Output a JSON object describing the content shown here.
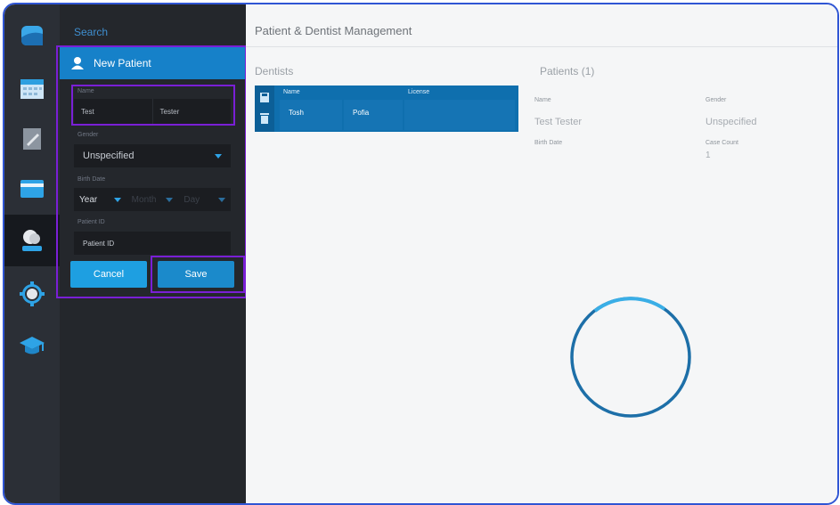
{
  "sidebar": {
    "search_label": "Search",
    "new_patient_label": "New Patient",
    "form": {
      "name_label": "Name",
      "first_name": "Test",
      "last_name": "Tester",
      "gender_label": "Gender",
      "gender_value": "Unspecified",
      "birth_date_label": "Birth Date",
      "year": "Year",
      "month": "Month",
      "day": "Day",
      "patient_id_label": "Patient ID",
      "patient_id_placeholder": "Patient ID",
      "cancel_label": "Cancel",
      "save_label": "Save"
    }
  },
  "main": {
    "title": "Patient & Dentist Management",
    "dentists": {
      "heading": "Dentists",
      "columns": [
        "Name",
        "License"
      ],
      "rows": [
        {
          "first": "Tosh",
          "last": "Pofia",
          "license": ""
        }
      ]
    },
    "patients": {
      "heading": "Patients",
      "count": "(1)",
      "name_label": "Name",
      "name_value": "Test Tester",
      "gender_label": "Gender",
      "gender_value": "Unspecified",
      "birth_date_label": "Birth Date",
      "case_count_label": "Case Count",
      "case_count_value": "1"
    }
  },
  "icons": [
    "app-logo-icon",
    "calendar-icon",
    "document-icon",
    "card-icon",
    "patients-icon",
    "settings-icon",
    "graduation-cap-icon",
    "save-icon",
    "delete-icon",
    "user-icon",
    "loading-spinner-icon"
  ],
  "colors": {
    "accent": "#1681c9",
    "highlight": "#7a1fd6",
    "frame": "#2f55d4"
  }
}
